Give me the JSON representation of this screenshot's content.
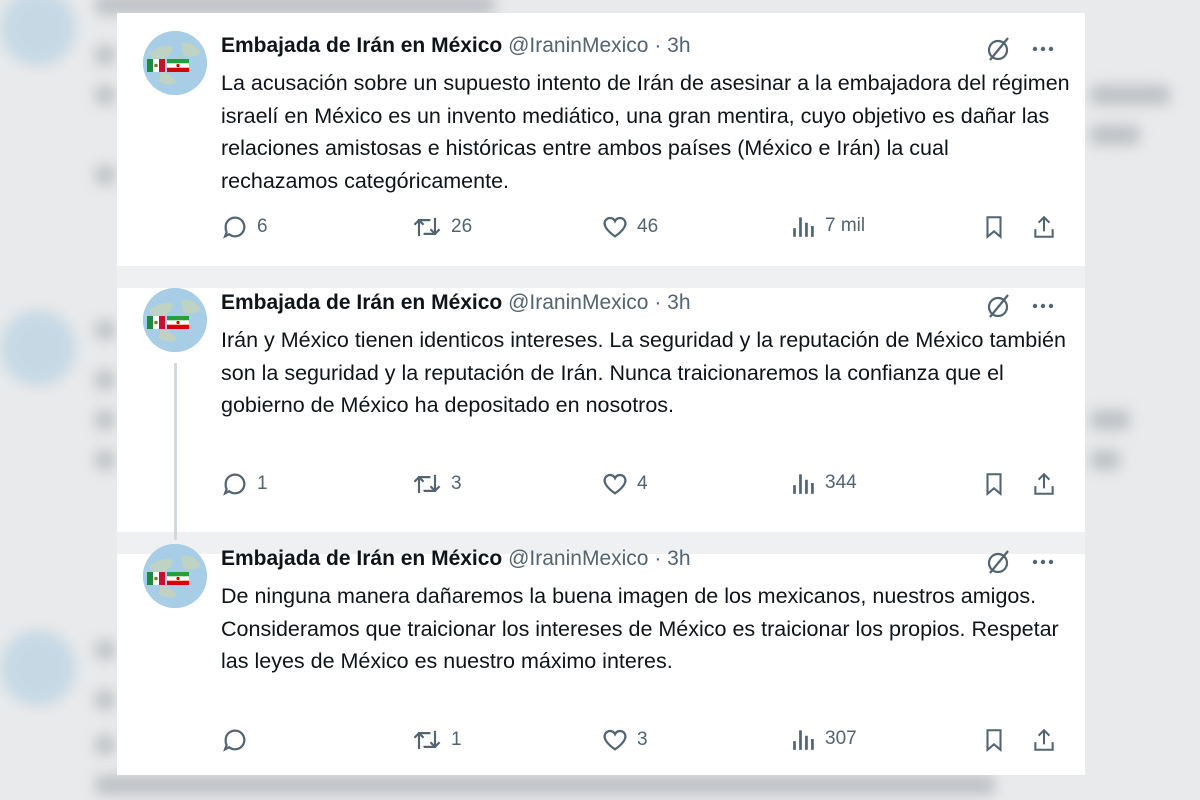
{
  "tweets": [
    {
      "name": "Embajada de Irán en México",
      "handle": "@IraninMexico",
      "separator": "·",
      "time": "3h",
      "text": "La acusación sobre un supuesto intento de Irán de asesinar a la embajadora del régimen israelí en México es un invento mediático, una gran mentira, cuyo objetivo es dañar las relaciones amistosas e históricas entre ambos países (México e Irán) la cual rechazamos categóricamente.",
      "replies": "6",
      "reposts": "26",
      "likes": "46",
      "views": "7 mil"
    },
    {
      "name": "Embajada de Irán en México",
      "handle": "@IraninMexico",
      "separator": "·",
      "time": "3h",
      "text": "Irán y México tienen identicos intereses. La seguridad y la reputación de México también son la seguridad y la reputación de Irán. Nunca traicionaremos la confianza que el gobierno de México ha depositado en nosotros.",
      "replies": "1",
      "reposts": "3",
      "likes": "4",
      "views": "344"
    },
    {
      "name": "Embajada de Irán en México",
      "handle": "@IraninMexico",
      "separator": "·",
      "time": "3h",
      "text": "De ninguna manera dañaremos la buena imagen de los mexicanos, nuestros amigos. Consideramos que traicionar los intereses de México es traicionar los propios. Respetar las leyes de México es nuestro máximo interes.",
      "replies": "",
      "reposts": "1",
      "likes": "3",
      "views": "307"
    }
  ],
  "colors": {
    "text": "#0f1419",
    "secondary": "#536471",
    "avatar_bg": "#a8cde6",
    "thread_line": "#cfd9de"
  },
  "icons": {
    "grok": "grok-icon",
    "more": "more-icon",
    "reply": "reply-icon",
    "repost": "repost-icon",
    "like": "like-icon",
    "views": "views-icon",
    "bookmark": "bookmark-icon",
    "share": "share-icon"
  }
}
